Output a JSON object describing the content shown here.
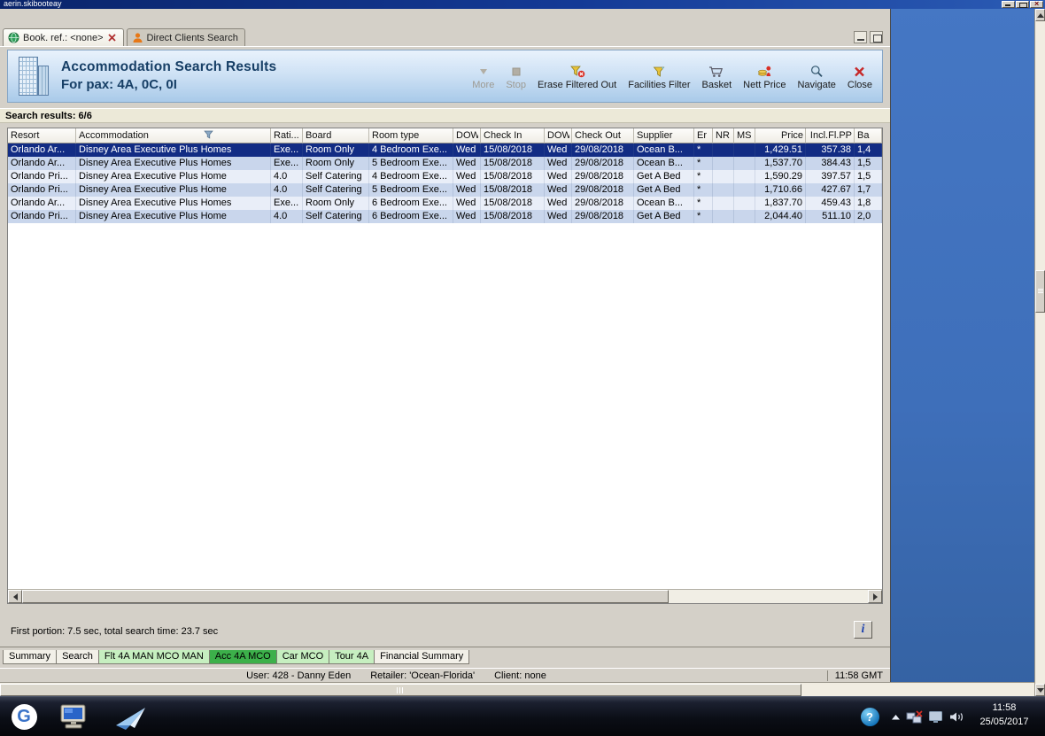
{
  "window": {
    "title": "aerin.skibooteay"
  },
  "doc_tabs": [
    {
      "label": "Book. ref.: <none>",
      "icon": "globe",
      "closable": true,
      "active": true
    },
    {
      "label": "Direct Clients Search",
      "icon": "person",
      "closable": false,
      "active": false
    }
  ],
  "header": {
    "title": "Accommodation Search Results",
    "subtitle": "For pax: 4A, 0C, 0I",
    "toolbar": [
      {
        "label": "More",
        "icon": "more-arrow",
        "disabled": true
      },
      {
        "label": "Stop",
        "icon": "stop-square",
        "disabled": true
      },
      {
        "label": "Erase Filtered Out",
        "icon": "erase-filter",
        "disabled": false
      },
      {
        "label": "Facilities Filter",
        "icon": "facilities-filter",
        "disabled": false
      },
      {
        "label": "Basket",
        "icon": "basket",
        "disabled": false
      },
      {
        "label": "Nett Price",
        "icon": "nett-price",
        "disabled": false
      },
      {
        "label": "Navigate",
        "icon": "navigate",
        "disabled": false
      },
      {
        "label": "Close",
        "icon": "close-red",
        "disabled": false
      }
    ]
  },
  "results": {
    "summary": "Search results: 6/6",
    "columns": [
      {
        "label": "Resort"
      },
      {
        "label": "Accommodation",
        "filter": true
      },
      {
        "label": "Rati..."
      },
      {
        "label": "Board"
      },
      {
        "label": "Room type"
      },
      {
        "label": "DOW"
      },
      {
        "label": "Check In"
      },
      {
        "label": "DOW"
      },
      {
        "label": "Check Out"
      },
      {
        "label": "Supplier"
      },
      {
        "label": "Er"
      },
      {
        "label": "NR"
      },
      {
        "label": "MS"
      },
      {
        "label": "Price",
        "align": "right"
      },
      {
        "label": "Incl.Fl.PP",
        "align": "right"
      },
      {
        "label": "Ba"
      }
    ],
    "rows": [
      {
        "selected": true,
        "cells": [
          "Orlando Ar...",
          "Disney Area Executive Plus Homes",
          "Exe...",
          "Room Only",
          "4 Bedroom Exe...",
          "Wed",
          "15/08/2018",
          "Wed",
          "29/08/2018",
          "Ocean B...",
          "*",
          "",
          "",
          "1,429.51",
          "357.38",
          "1,4"
        ]
      },
      {
        "selected": false,
        "cells": [
          "Orlando Ar...",
          "Disney Area Executive Plus Homes",
          "Exe...",
          "Room Only",
          "5 Bedroom Exe...",
          "Wed",
          "15/08/2018",
          "Wed",
          "29/08/2018",
          "Ocean B...",
          "*",
          "",
          "",
          "1,537.70",
          "384.43",
          "1,5"
        ]
      },
      {
        "selected": false,
        "cells": [
          "Orlando Pri...",
          "Disney Area Executive Plus Home",
          "4.0",
          "Self Catering",
          "4 Bedroom Exe...",
          "Wed",
          "15/08/2018",
          "Wed",
          "29/08/2018",
          "Get A Bed",
          "*",
          "",
          "",
          "1,590.29",
          "397.57",
          "1,5"
        ]
      },
      {
        "selected": false,
        "cells": [
          "Orlando Pri...",
          "Disney Area Executive Plus Home",
          "4.0",
          "Self Catering",
          "5 Bedroom Exe...",
          "Wed",
          "15/08/2018",
          "Wed",
          "29/08/2018",
          "Get A Bed",
          "*",
          "",
          "",
          "1,710.66",
          "427.67",
          "1,7"
        ]
      },
      {
        "selected": false,
        "cells": [
          "Orlando Ar...",
          "Disney Area Executive Plus Homes",
          "Exe...",
          "Room Only",
          "6 Bedroom Exe...",
          "Wed",
          "15/08/2018",
          "Wed",
          "29/08/2018",
          "Ocean B...",
          "*",
          "",
          "",
          "1,837.70",
          "459.43",
          "1,8"
        ]
      },
      {
        "selected": false,
        "cells": [
          "Orlando Pri...",
          "Disney Area Executive Plus Home",
          "4.0",
          "Self Catering",
          "6 Bedroom Exe...",
          "Wed",
          "15/08/2018",
          "Wed",
          "29/08/2018",
          "Get A Bed",
          "*",
          "",
          "",
          "2,044.40",
          "511.10",
          "2,0"
        ]
      }
    ]
  },
  "footer": {
    "timing": "First portion: 7.5 sec, total search time: 23.7 sec",
    "info_label": "i"
  },
  "bottom_tabs": [
    {
      "label": "Summary",
      "variant": "plain"
    },
    {
      "label": "Search",
      "variant": "plain"
    },
    {
      "label": "Flt 4A MAN MCO MAN",
      "variant": "green-light"
    },
    {
      "label": "Acc 4A MCO",
      "variant": "green-active"
    },
    {
      "label": "Car MCO",
      "variant": "green-light"
    },
    {
      "label": "Tour 4A",
      "variant": "green-light"
    },
    {
      "label": "Financial Summary",
      "variant": "plain"
    }
  ],
  "statusbar": {
    "user": "User: 428 - Danny Eden",
    "retailer": "Retailer: 'Ocean-Florida'",
    "client": "Client: none",
    "time": "11:58 GMT"
  },
  "taskbar": {
    "clock_time": "11:58",
    "clock_date": "25/05/2017"
  }
}
